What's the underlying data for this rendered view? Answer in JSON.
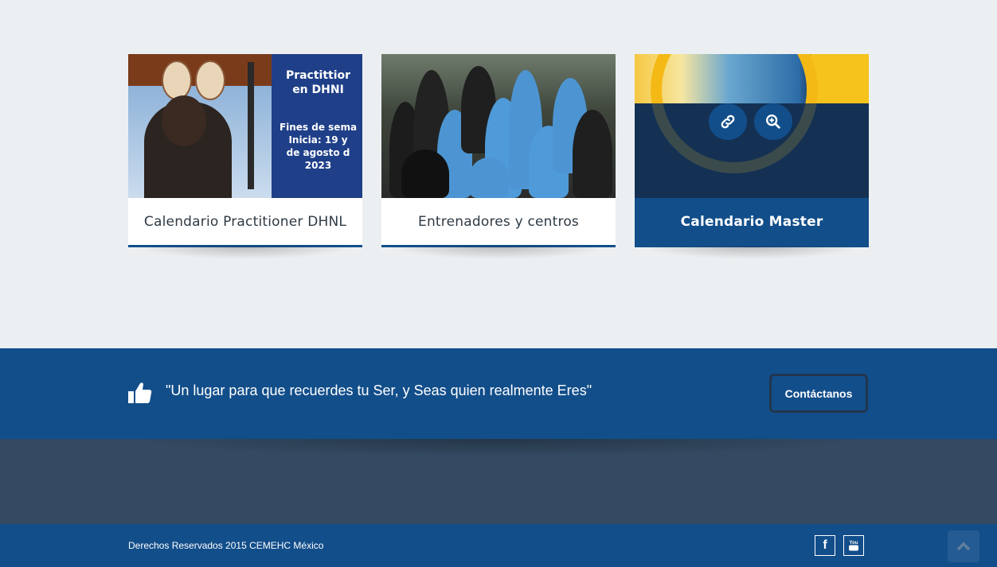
{
  "cards": [
    {
      "title": "Calendario Practitioner DHNL",
      "poster_lines": [
        "Practittior",
        "en DHNI"
      ],
      "poster_sub": [
        "Fines de sema",
        "Inicia:  19 y",
        "de agosto d",
        "2023"
      ]
    },
    {
      "title": "Entrenadores y centros"
    },
    {
      "title": "Calendario Master",
      "actions": [
        "link-icon",
        "zoom-in-icon"
      ]
    }
  ],
  "banner": {
    "quote": "\"Un lugar para que recuerdes tu Ser, y Seas quien realmente Eres\"",
    "icon": "thumbs-up-icon",
    "contact_label": "Contáctanos"
  },
  "footer": {
    "copyright": "Derechos Reservados 2015 CEMEHC México",
    "social": [
      "facebook-icon",
      "youtube-icon"
    ],
    "youtube_label": "You"
  },
  "colors": {
    "brand_blue": "#124e8a",
    "dark_band": "#334a62",
    "page_bg": "#eceff1"
  }
}
